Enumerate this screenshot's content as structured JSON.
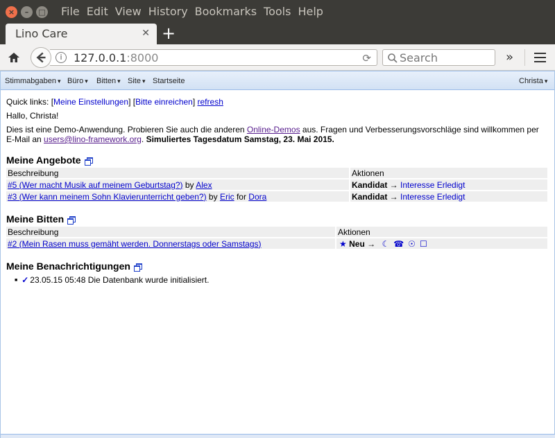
{
  "os_menubar": {
    "items": [
      "File",
      "Edit",
      "View",
      "History",
      "Bookmarks",
      "Tools",
      "Help"
    ]
  },
  "tab": {
    "title": "Lino Care"
  },
  "navbar": {
    "url_host": "127.0.0.1",
    "url_port": ":8000",
    "search_placeholder": "Search"
  },
  "appbar": {
    "menus": [
      "Stimmabgaben",
      "Büro",
      "Bitten",
      "Site"
    ],
    "start": "Startseite",
    "user": "Christa"
  },
  "content": {
    "quick_prefix": "Quick links: ",
    "quick_link1": "Meine Einstellungen",
    "quick_link2": "Bitte einreichen",
    "quick_refresh": "refresh",
    "hello": "Hallo, Christa!",
    "demo_part1": "Dies ist eine Demo-Anwendung. Probieren Sie auch die anderen ",
    "demo_link": "Online-Demos",
    "demo_part2": " aus. Fragen und Verbesserungsvorschläge sind willkommen per E-Mail an ",
    "demo_email": "users@lino-framework.org",
    "demo_part3": ". ",
    "demo_bold": "Simuliertes Tagesdatum Samstag, 23. Mai 2015.",
    "angebote": {
      "title": "Meine Angebote",
      "col_desc": "Beschreibung",
      "col_actions": "Aktionen",
      "rows": [
        {
          "link": "#5 (Wer macht Musik auf meinem Geburtstag?)",
          "by": " by ",
          "user": "Alex",
          "for": "",
          "for_user": "",
          "state": "Kandidat",
          "arrow": " → ",
          "act1": "Interesse",
          "act2": "Erledigt"
        },
        {
          "link": "#3 (Wer kann meinem Sohn Klavierunterricht geben?)",
          "by": " by ",
          "user": "Eric",
          "for": " for ",
          "for_user": "Dora",
          "state": "Kandidat",
          "arrow": " → ",
          "act1": "Interesse",
          "act2": "Erledigt"
        }
      ]
    },
    "bitten": {
      "title": "Meine Bitten",
      "col_desc": "Beschreibung",
      "col_actions": "Aktionen",
      "row": {
        "link": "#2 (Mein Rasen muss gemäht werden. Donnerstags oder Samstags)",
        "star": "★",
        "state": "Neu",
        "arrow": " → ",
        "icons": [
          "☾",
          "☎",
          "☉",
          "☐"
        ]
      }
    },
    "benachrichtigungen": {
      "title": "Meine Benachrichtigungen",
      "items": [
        {
          "check": "✓",
          "text": "23.05.15 05:48 Die Datenbank wurde initialisiert."
        }
      ]
    }
  }
}
